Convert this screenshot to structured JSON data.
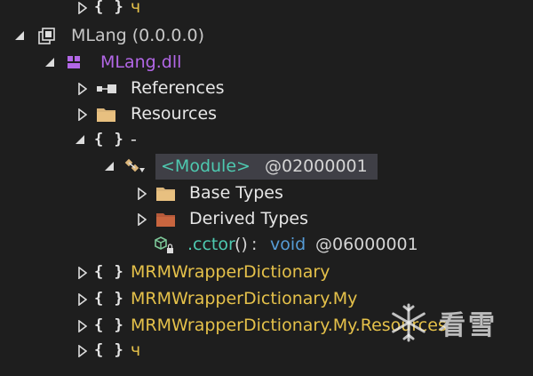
{
  "tree": {
    "top_namespace": {
      "label": "ч"
    },
    "assembly": {
      "label": "MLang (0.0.0.0)"
    },
    "module": {
      "label": "MLang.dll"
    },
    "references": {
      "label": "References"
    },
    "resources": {
      "label": "Resources"
    },
    "empty_namespace": {
      "label": "-"
    },
    "module_type": {
      "name": "<Module>",
      "token": "@02000001"
    },
    "base_types": {
      "label": "Base Types"
    },
    "derived_types": {
      "label": "Derived Types"
    },
    "cctor": {
      "name": ".cctor",
      "params": "()",
      "separator": " : ",
      "return_type": "void",
      "token": "@06000001"
    },
    "namespaces": [
      {
        "label": "MRMWrapperDictionary"
      },
      {
        "label": "MRMWrapperDictionary.My"
      },
      {
        "label": "MRMWrapperDictionary.My.Resources"
      },
      {
        "label": "ч"
      }
    ],
    "namespace_icon_text": "{ }"
  },
  "watermark": {
    "text": "看雪",
    "icon": "snowflake-icon"
  },
  "colors": {
    "background": "#1e1e1e",
    "selection": "#3f3f46",
    "namespace_yellow": "#e5c14a",
    "module_purple": "#b267e6",
    "type_teal": "#4ec9b0",
    "keyword_blue": "#569cd6"
  }
}
